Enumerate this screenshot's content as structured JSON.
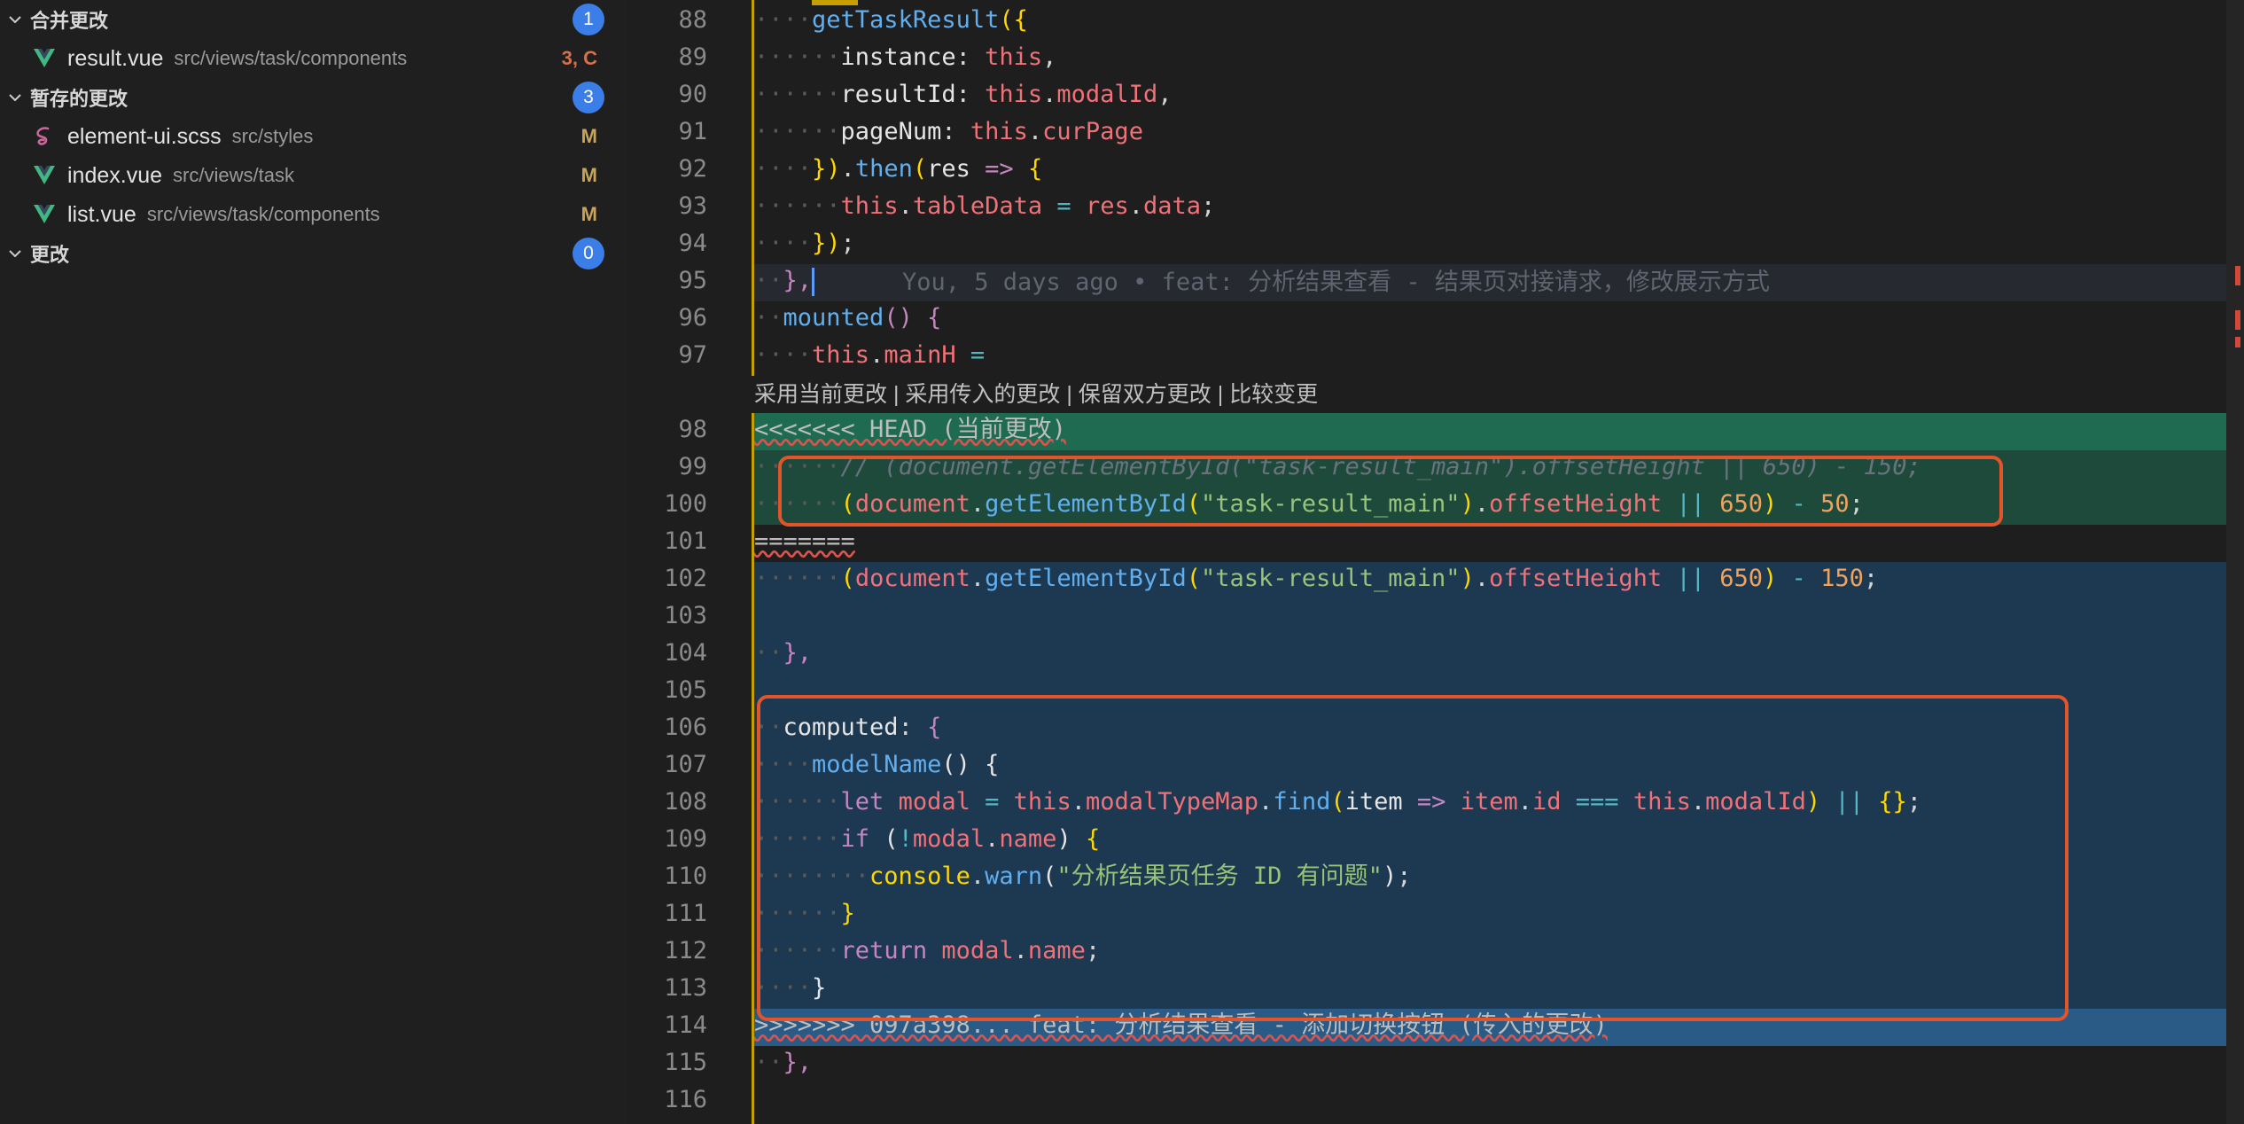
{
  "scm": {
    "groups": [
      {
        "label": "合并更改",
        "count": "1",
        "files": [
          {
            "name": "result.vue",
            "path": "src/views/task/components",
            "status": "3, C",
            "icon": "vue-icon"
          }
        ]
      },
      {
        "label": "暂存的更改",
        "count": "3",
        "files": [
          {
            "name": "element-ui.scss",
            "path": "src/styles",
            "status": "M",
            "icon": "sass-icon"
          },
          {
            "name": "index.vue",
            "path": "src/views/task",
            "status": "M",
            "icon": "vue-icon"
          },
          {
            "name": "list.vue",
            "path": "src/views/task/components",
            "status": "M",
            "icon": "vue-icon"
          }
        ]
      },
      {
        "label": "更改",
        "count": "0",
        "files": []
      }
    ]
  },
  "editor": {
    "line_numbers": [
      "88",
      "89",
      "90",
      "91",
      "92",
      "93",
      "94",
      "95",
      "96",
      "97",
      "98",
      "99",
      "100",
      "101",
      "102",
      "103",
      "104",
      "105",
      "106",
      "107",
      "108",
      "109",
      "110",
      "111",
      "112",
      "113",
      "114",
      "115",
      "116"
    ],
    "blame": "You, 5 days ago • feat: 分析结果查看 - 结果页对接请求，修改展示方式",
    "codelens": "采用当前更改 | 采用传入的更改 | 保留双方更改 | 比较变更",
    "head_marker": "<<<<<<< HEAD (当前更改)",
    "separator": "=======",
    "incoming_marker": ">>>>>>> 097a398... feat: 分析结果查看 - 添加切换按钮 (传入的更改)",
    "console_msg": "\"分析结果页任务 ID 有问题\"",
    "selector_str": "\"task-result_main\"",
    "commented_line": "// (document.getElementById(\"task-result_main\").offsetHeight || 650) - 150;",
    "num_650": "650",
    "num_50": "50",
    "num_150": "150"
  },
  "colors": {
    "accent": "#3c7ee8",
    "conflict": "#d7704a",
    "modified": "#c9a45a",
    "vue": "#41b883",
    "sass": "#cd6799",
    "current_band": "#1e4a3c",
    "incoming_band": "#1d3851",
    "annotation": "#e2542a"
  }
}
